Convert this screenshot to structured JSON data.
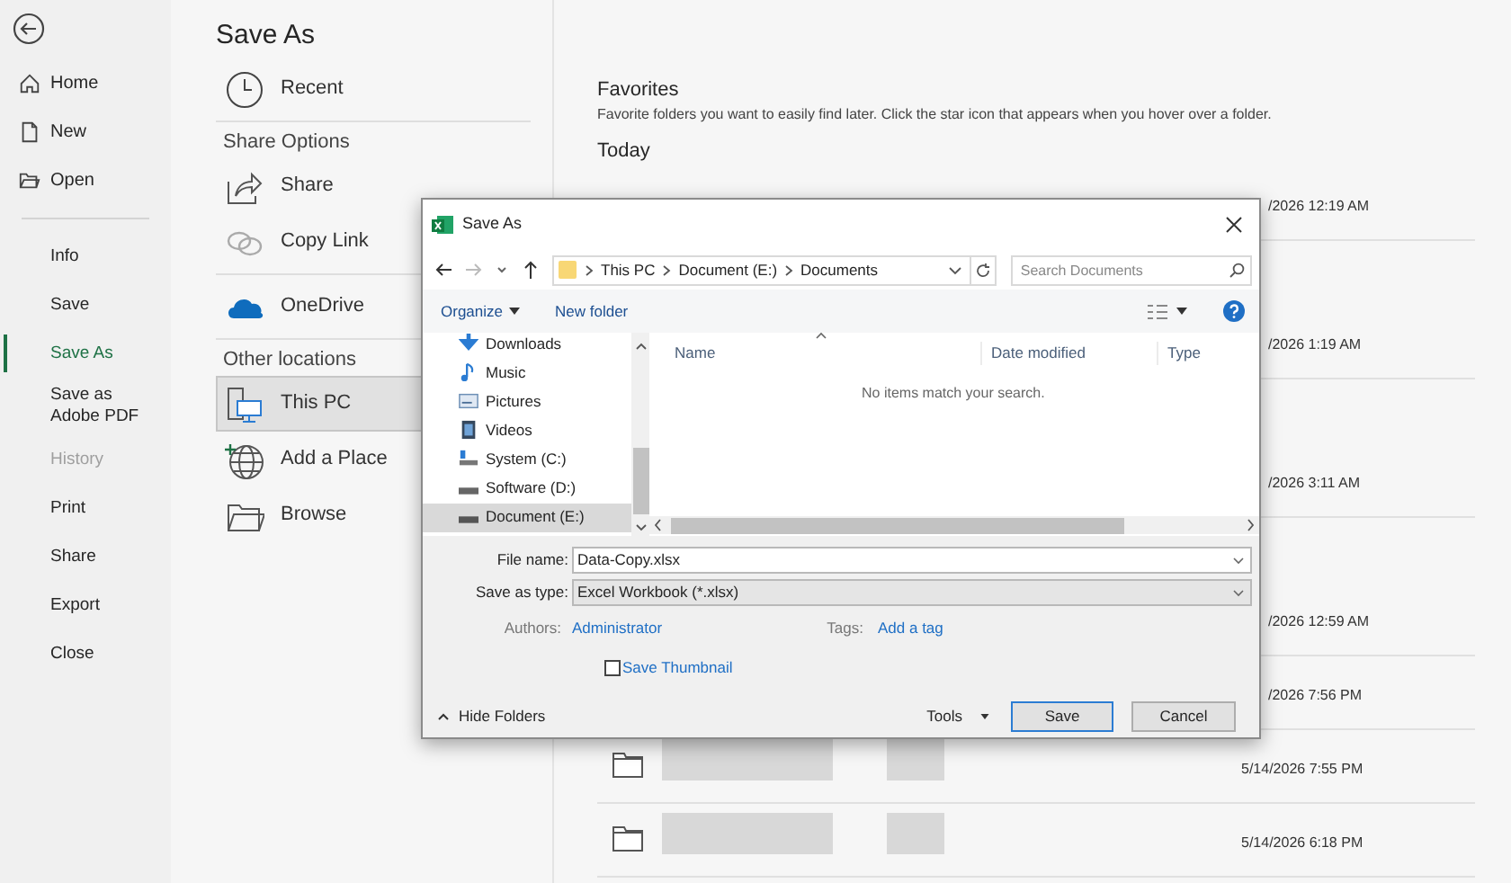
{
  "nav_top": [
    {
      "label": "Home",
      "selected": false,
      "disabled": false
    },
    {
      "label": "New",
      "selected": false,
      "disabled": false
    },
    {
      "label": "Open",
      "selected": false,
      "disabled": false
    }
  ],
  "nav_bottom": [
    {
      "label": "Info",
      "selected": false,
      "disabled": false
    },
    {
      "label": "Save",
      "selected": false,
      "disabled": false
    },
    {
      "label": "Save As",
      "selected": true,
      "disabled": false
    },
    {
      "label": "Save as Adobe PDF",
      "selected": false,
      "disabled": false
    },
    {
      "label": "History",
      "selected": false,
      "disabled": true
    },
    {
      "label": "Print",
      "selected": false,
      "disabled": false
    },
    {
      "label": "Share",
      "selected": false,
      "disabled": false
    },
    {
      "label": "Export",
      "selected": false,
      "disabled": false
    },
    {
      "label": "Close",
      "selected": false,
      "disabled": false
    }
  ],
  "page_title": "Save As",
  "location_sections": [
    {
      "items": [
        {
          "label": "Recent",
          "selected": false
        }
      ]
    },
    {
      "heading": "Share Options",
      "items": [
        {
          "label": "Share",
          "selected": false
        },
        {
          "label": "Copy Link",
          "selected": false
        }
      ]
    },
    {
      "items": [
        {
          "label": "OneDrive",
          "selected": false
        }
      ]
    },
    {
      "heading": "Other locations",
      "items": [
        {
          "label": "This PC",
          "selected": true
        },
        {
          "label": "Add a Place",
          "selected": false
        },
        {
          "label": "Browse",
          "selected": false
        }
      ]
    }
  ],
  "favorites": {
    "title": "Favorites",
    "description": "Favorite folders you want to easily find later. Click the star icon that appears when you hover over a folder."
  },
  "group_title": "Today",
  "recent_rows": [
    {
      "kind": "short",
      "date": "/2026 12:19 AM",
      "cut": true,
      "blurred": false
    },
    {
      "kind": "tall",
      "date": "/2026 1:19 AM",
      "cut": true,
      "blurred": false
    },
    {
      "kind": "tall",
      "date": "/2026 3:11 AM",
      "cut": true,
      "blurred": false
    },
    {
      "kind": "tall",
      "date": "/2026 12:59 AM",
      "cut": true,
      "blurred": false
    },
    {
      "kind": "short",
      "date": "/2026 7:56 PM",
      "cut": true,
      "blurred": false
    },
    {
      "kind": "short",
      "date": "5/14/2026 7:55 PM",
      "cut": false,
      "blurred": true
    },
    {
      "kind": "short",
      "date": "5/14/2026 6:18 PM",
      "cut": false,
      "blurred": true
    }
  ],
  "dialog": {
    "title": "Save As",
    "breadcrumb": [
      "This PC",
      "Document (E:)",
      "Documents"
    ],
    "search_placeholder": "Search Documents",
    "toolbar": {
      "organize": "Organize",
      "new_folder": "New folder"
    },
    "nav_items": [
      {
        "label": "Downloads",
        "selected": false
      },
      {
        "label": "Music",
        "selected": false
      },
      {
        "label": "Pictures",
        "selected": false
      },
      {
        "label": "Videos",
        "selected": false
      },
      {
        "label": "System (C:)",
        "selected": false
      },
      {
        "label": "Software (D:)",
        "selected": false
      },
      {
        "label": "Document (E:)",
        "selected": true
      }
    ],
    "columns": [
      "Name",
      "Date modified",
      "Type"
    ],
    "empty_message": "No items match your search.",
    "file_name_label": "File name:",
    "file_name": "Data-Copy.xlsx",
    "type_label": "Save as type:",
    "type_value": "Excel Workbook (*.xlsx)",
    "authors_label": "Authors:",
    "authors_value": "Administrator",
    "tags_label": "Tags:",
    "tags_value": "Add a tag",
    "thumbnail": {
      "label": "Save Thumbnail",
      "checked": false
    },
    "hide_folders": "Hide Folders",
    "tools": "Tools",
    "save": "Save",
    "cancel": "Cancel"
  }
}
